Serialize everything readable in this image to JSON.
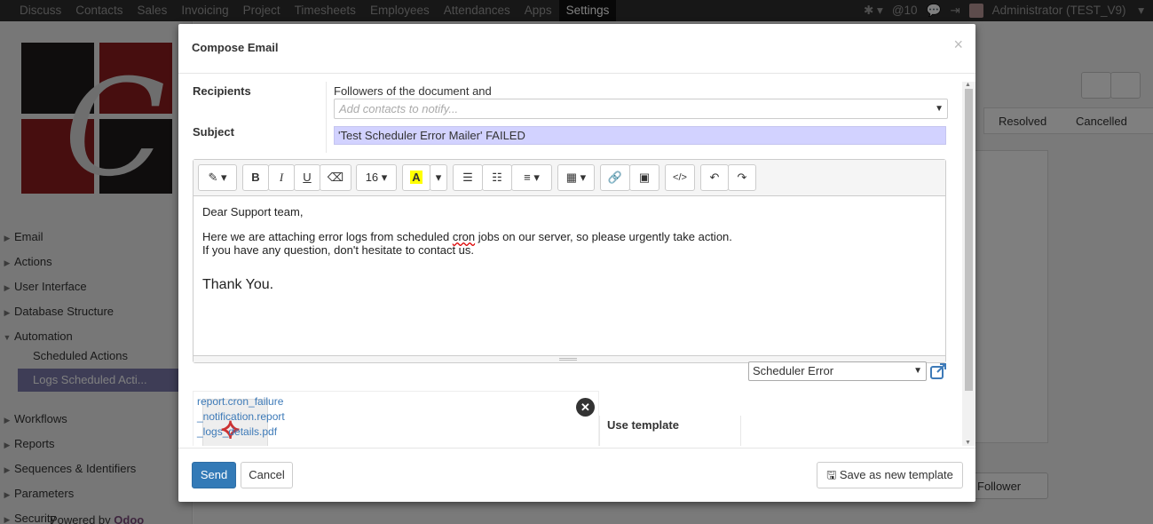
{
  "topbar": {
    "menu": [
      "Discuss",
      "Contacts",
      "Sales",
      "Invoicing",
      "Project",
      "Timesheets",
      "Employees",
      "Attendances",
      "Apps",
      "Settings"
    ],
    "active": "Settings",
    "messages_count": "@10",
    "user": "Administrator (TEST_V9)"
  },
  "sidebar": {
    "items": [
      {
        "label": "Email"
      },
      {
        "label": "Actions"
      },
      {
        "label": "User Interface"
      },
      {
        "label": "Database Structure"
      },
      {
        "label": "Automation"
      },
      {
        "label": "Workflows"
      },
      {
        "label": "Reports"
      },
      {
        "label": "Sequences & Identifiers"
      },
      {
        "label": "Parameters"
      },
      {
        "label": "Security"
      }
    ],
    "sub_items": [
      "Scheduled Actions",
      "Logs Scheduled Acti..."
    ],
    "powered_by": "Powered by",
    "powered_brand": "Odoo"
  },
  "background": {
    "stage_resolved": "Resolved",
    "stage_cancelled": "Cancelled",
    "follower_button": "Follower"
  },
  "modal": {
    "title": "Compose Email",
    "recipients_label": "Recipients",
    "recipients_text": "Followers of the document and",
    "contacts_placeholder": "Add contacts to notify...",
    "subject_label": "Subject",
    "subject_value": "'Test Scheduler Error Mailer' FAILED",
    "editor": {
      "font_size": "16",
      "body_line1": "Dear Support team,",
      "body_line2a": "Here we are attaching error logs from scheduled ",
      "body_line2_misspelled": "cron",
      "body_line2b": " jobs on our server, so please urgently take action.",
      "body_line3": "If you have any question, don't hesitate to contact us.",
      "body_thanks": "Thank You."
    },
    "attachment": {
      "name_line1": "report.cron_failure",
      "name_line2": "_notification.report",
      "name_line3": "_logs_details.pdf"
    },
    "use_template_label": "Use template",
    "template_value": "Scheduler Error",
    "send_label": "Send",
    "cancel_label": "Cancel",
    "save_template_label": "Save as new template"
  },
  "colors": {
    "primary": "#337ab7",
    "subject_highlight": "#d2d2ff",
    "sidebar_active": "#7c7bad",
    "topbar": "#2f2f2f"
  }
}
